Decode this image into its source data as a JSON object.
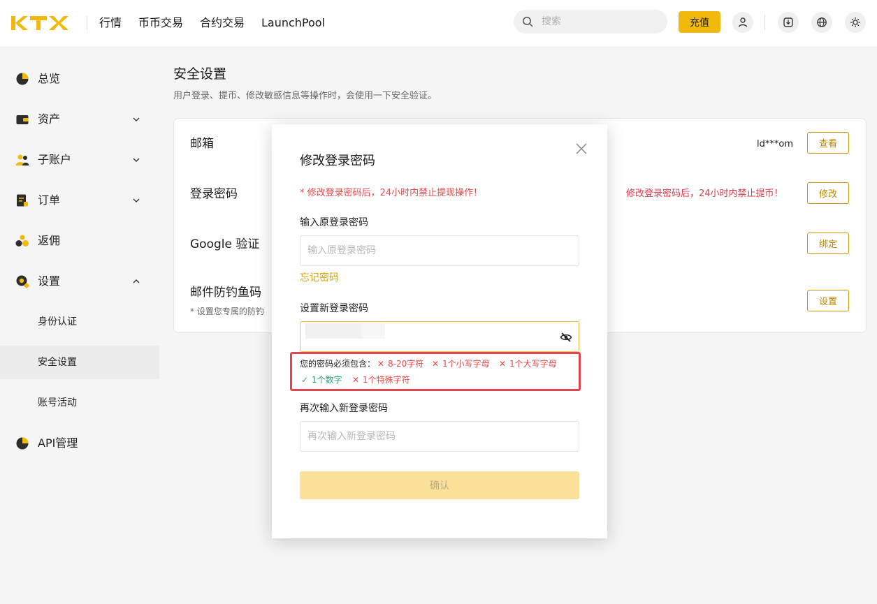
{
  "header": {
    "logo_text": "KTX",
    "nav": [
      {
        "label": "行情"
      },
      {
        "label": "币币交易"
      },
      {
        "label": "合约交易"
      },
      {
        "label": "LaunchPool"
      }
    ],
    "search_placeholder": "搜索",
    "deposit_label": "充值",
    "icons": [
      "user-icon",
      "download-icon",
      "globe-icon",
      "sun-icon"
    ]
  },
  "sidebar": {
    "items": [
      {
        "label": "总览",
        "icon": "overview-icon",
        "chevron": ""
      },
      {
        "label": "资产",
        "icon": "wallet-icon",
        "chevron": "down"
      },
      {
        "label": "子账户",
        "icon": "sub-account-icon",
        "chevron": "down"
      },
      {
        "label": "订单",
        "icon": "order-icon",
        "chevron": "down"
      },
      {
        "label": "返佣",
        "icon": "rebate-icon",
        "chevron": ""
      },
      {
        "label": "设置",
        "icon": "settings-icon",
        "chevron": "up"
      },
      {
        "label": "API管理",
        "icon": "api-icon",
        "chevron": ""
      }
    ],
    "sub_items": [
      {
        "label": "身份认证",
        "active": false
      },
      {
        "label": "安全设置",
        "active": true
      },
      {
        "label": "账号活动",
        "active": false
      }
    ]
  },
  "main": {
    "title": "安全设置",
    "description": "用户登录、提币、修改敏感信息等操作时，会使用一下安全验证。",
    "rows": [
      {
        "title": "邮箱",
        "value": "ld***om",
        "button": "查看"
      },
      {
        "title": "登录密码",
        "value": "修改登录密码后，24小时内禁止提币！",
        "button": "修改"
      },
      {
        "title": "Google 验证",
        "value": "",
        "button": "绑定"
      },
      {
        "title": "邮件防钓鱼码",
        "subtitle": "* 设置您专属的防钓",
        "value": "",
        "button": "设置"
      }
    ]
  },
  "modal": {
    "title": "修改登录密码",
    "warning": "* 修改登录密码后，24小时内禁止提现操作！",
    "old_password_label": "输入原登录密码",
    "old_password_placeholder": "输入原登录密码",
    "forgot_label": "忘记密码",
    "new_password_label": "设置新登录密码",
    "new_password_value": "",
    "requirements_lead": "您的密码必须包含：",
    "requirements": [
      {
        "label": "8-20字符",
        "met": false
      },
      {
        "label": "1个小写字母",
        "met": false
      },
      {
        "label": "1个大写字母",
        "met": false
      },
      {
        "label": "1个数字",
        "met": true
      },
      {
        "label": "1个特殊字符",
        "met": false
      }
    ],
    "confirm_password_label": "再次输入新登录密码",
    "confirm_password_placeholder": "再次输入新登录密码",
    "confirm_label": "确认"
  },
  "colors": {
    "accent": "#f0b90b",
    "error": "#e34a4a",
    "success": "#26a17b",
    "highlight_border": "#e0474c"
  }
}
